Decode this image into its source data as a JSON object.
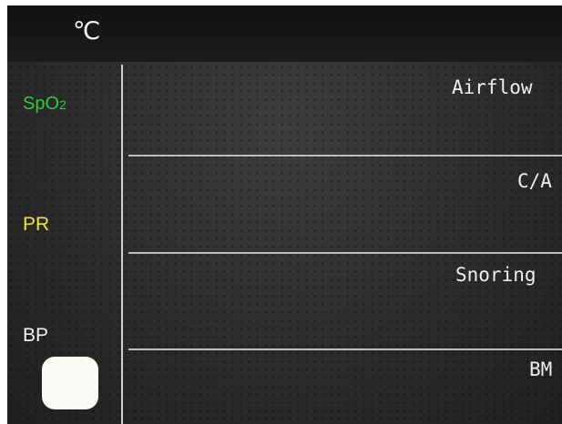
{
  "header": {
    "unit": "℃"
  },
  "vitals": {
    "spo2_main": "SpO",
    "spo2_sub": "2",
    "pr": "PR",
    "bp": "BP"
  },
  "channels": {
    "airflow": "Airflow",
    "ca": "C/A",
    "snoring": "Snoring",
    "bm": "BM"
  },
  "colors": {
    "spo2": "#2ecc40",
    "pr": "#f3e23a",
    "bp": "#f2f2f2",
    "background": "#2c2c2c"
  },
  "icons": {
    "bp_button": "rounded-square-button"
  }
}
